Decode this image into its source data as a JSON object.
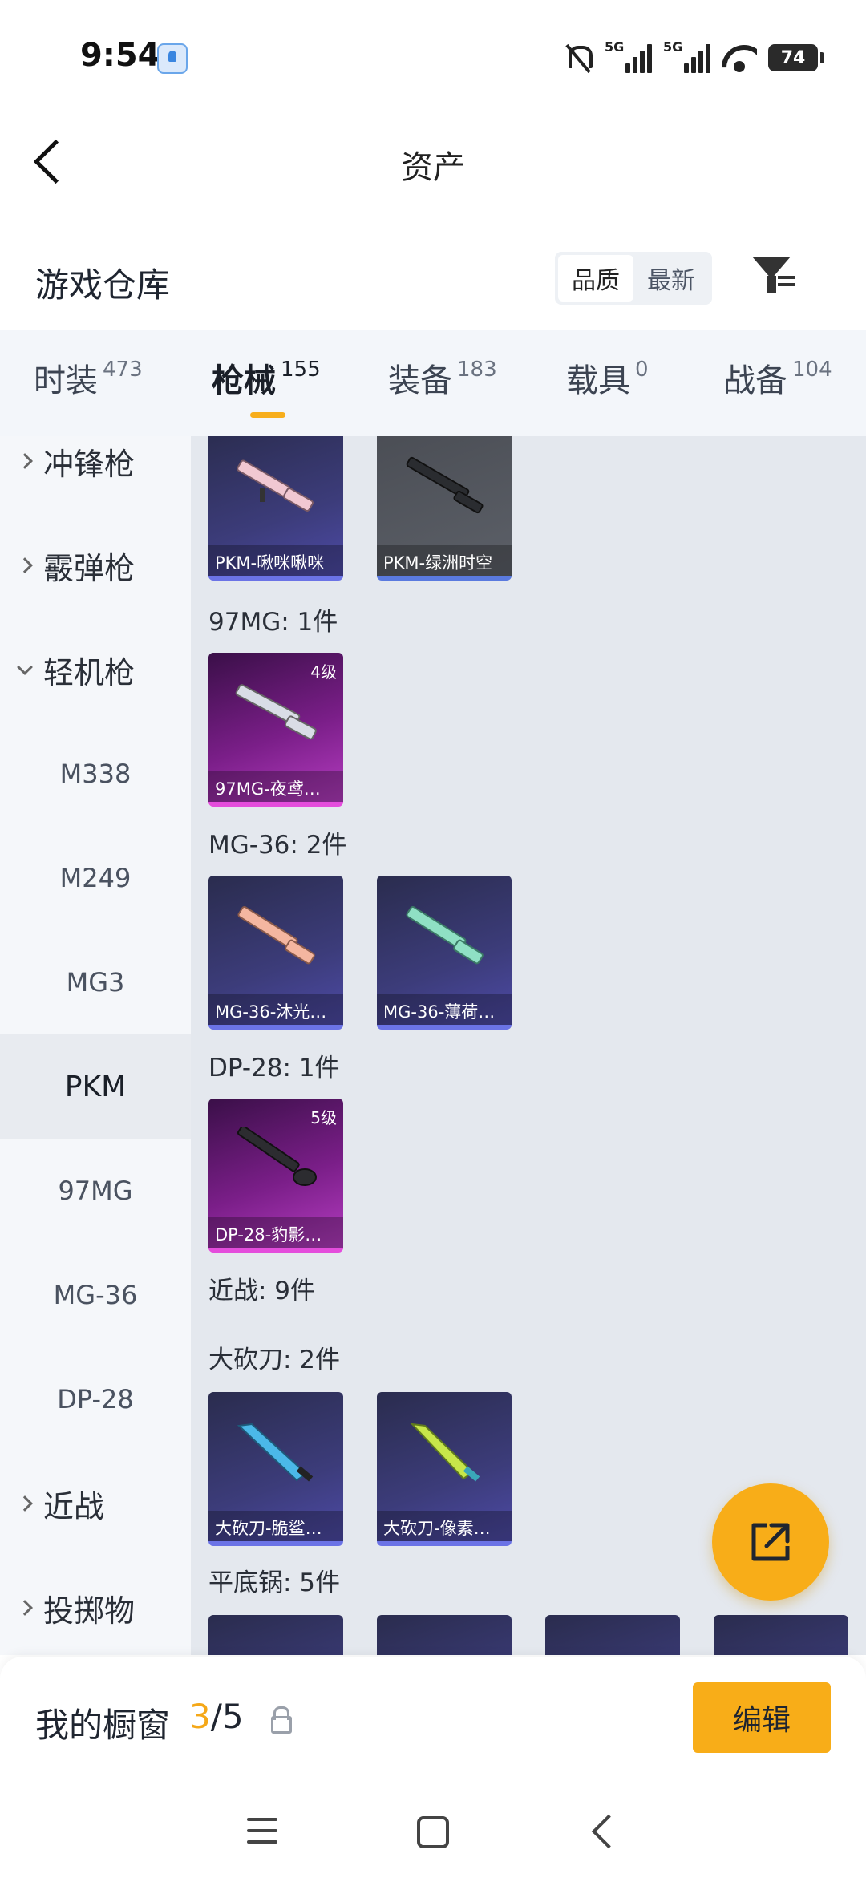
{
  "status_bar": {
    "time": "9:54",
    "network_1": "5G",
    "network_2": "5G",
    "battery": "74"
  },
  "header": {
    "title": "资产",
    "warehouse_title": "游戏仓库"
  },
  "sort": {
    "quality": "品质",
    "newest": "最新",
    "active": "quality"
  },
  "tabs": [
    {
      "label": "时装",
      "count": "473"
    },
    {
      "label": "枪械",
      "count": "155",
      "active": true
    },
    {
      "label": "装备",
      "count": "183"
    },
    {
      "label": "载具",
      "count": "0"
    },
    {
      "label": "战备",
      "count": "104"
    }
  ],
  "sidebar": {
    "items": [
      {
        "label": "冲锋枪",
        "type": "group"
      },
      {
        "label": "霰弹枪",
        "type": "group"
      },
      {
        "label": "轻机枪",
        "type": "group",
        "open": true
      },
      {
        "label": "M338",
        "type": "sub"
      },
      {
        "label": "M249",
        "type": "sub"
      },
      {
        "label": "MG3",
        "type": "sub"
      },
      {
        "label": "PKM",
        "type": "sub",
        "selected": true
      },
      {
        "label": "97MG",
        "type": "sub"
      },
      {
        "label": "MG-36",
        "type": "sub"
      },
      {
        "label": "DP-28",
        "type": "sub"
      },
      {
        "label": "近战",
        "type": "group"
      },
      {
        "label": "投掷物",
        "type": "group"
      }
    ]
  },
  "content": {
    "pkm_cards": [
      {
        "name": "PKM-啾咪啾咪",
        "rarity": "blue"
      },
      {
        "name": "PKM-绿洲时空",
        "rarity": "gray"
      }
    ],
    "sec_97mg": "97MG: 1件",
    "card_97mg": {
      "name": "97MG-夜鸢…",
      "level": "4级",
      "rarity": "purple"
    },
    "sec_mg36": "MG-36: 2件",
    "mg36_cards": [
      {
        "name": "MG-36-沐光…",
        "rarity": "blue"
      },
      {
        "name": "MG-36-薄荷…",
        "rarity": "blue"
      }
    ],
    "sec_dp28": "DP-28: 1件",
    "card_dp28": {
      "name": "DP-28-豹影…",
      "level": "5级",
      "rarity": "purple"
    },
    "sec_melee": "近战: 9件",
    "sec_machete": "大砍刀: 2件",
    "machete_cards": [
      {
        "name": "大砍刀-脆鲨…",
        "rarity": "blue"
      },
      {
        "name": "大砍刀-像素…",
        "rarity": "blue"
      }
    ],
    "sec_pan": "平底锅: 5件"
  },
  "showcase": {
    "label": "我的橱窗",
    "current": "3",
    "separator": "/",
    "total": "5",
    "edit_label": "编辑"
  },
  "colors": {
    "accent": "#f8ad18",
    "card_blue": "#3c3c7a",
    "card_purple": "#7a1e88"
  }
}
